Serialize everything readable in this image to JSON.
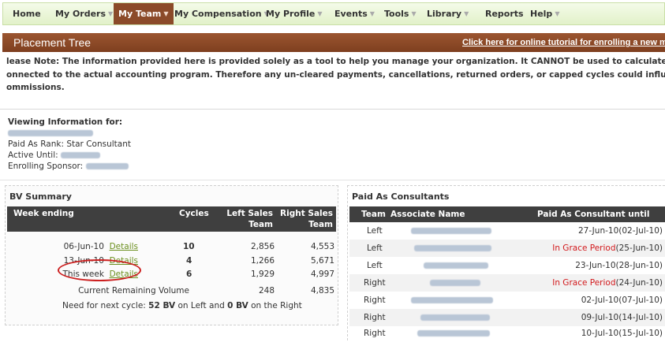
{
  "nav": {
    "items": [
      {
        "label": "Home",
        "caret": false
      },
      {
        "label": "My Orders",
        "caret": true
      },
      {
        "label": "My Team",
        "caret": true,
        "active": true
      },
      {
        "label": "My Compensation",
        "caret": true
      },
      {
        "label": "My Profile",
        "caret": true
      },
      {
        "label": "Events",
        "caret": true
      },
      {
        "label": "Tools",
        "caret": true
      },
      {
        "label": "Library",
        "caret": true
      },
      {
        "label": "Reports",
        "caret": false
      },
      {
        "label": "Help",
        "caret": true
      }
    ]
  },
  "header": {
    "title": "Placement Tree",
    "tutorial_link": "Click here for online tutorial for enrolling a new m"
  },
  "note": {
    "line1": "lease Note: The information provided here is provided solely as a tool to help you manage your organization. It CANNOT be used to calculate your commission checks a",
    "line2": "onnected to the actual accounting program. Therefore any un-cleared payments, cancellations, returned orders, or capped cycles could influence your ultimate status a",
    "line3": "ommissions."
  },
  "viewing": {
    "heading": "Viewing Information for:",
    "rank_label": "Paid As Rank:",
    "rank_value": "Star Consultant",
    "active_label": "Active Until:",
    "sponsor_label": "Enrolling Sponsor:"
  },
  "bv_summary": {
    "title": "BV Summary",
    "columns": [
      "Week ending",
      "Cycles",
      "Left Sales",
      "Team",
      "Right Sales",
      "Team"
    ],
    "rows": [
      {
        "week": "06-Jun-10",
        "link": "Details",
        "cycles": "10",
        "left": "2,856",
        "right": "4,553"
      },
      {
        "week": "13-Jun-10",
        "link": "Details",
        "cycles": "4",
        "left": "1,266",
        "right": "5,671"
      },
      {
        "week": "This week",
        "link": "Details",
        "cycles": "6",
        "left": "1,929",
        "right": "4,997"
      }
    ],
    "remaining_label": "Current Remaining Volume",
    "remaining_left": "248",
    "remaining_right": "4,835",
    "need_prefix": "Need for next cycle:",
    "need_left": "52 BV",
    "need_mid": "on Left and",
    "need_right": "0 BV",
    "need_suffix": "on the Right"
  },
  "paid_as": {
    "title": "Paid As Consultants",
    "columns": [
      "Team",
      "Associate Name",
      "Paid As Consultant until"
    ],
    "rows": [
      {
        "team": "Left",
        "grace": "",
        "until": "27-Jun-10(02-Jul-10)"
      },
      {
        "team": "Left",
        "grace": "In Grace Period",
        "until": "(25-Jun-10)"
      },
      {
        "team": "Left",
        "grace": "",
        "until": "23-Jun-10(28-Jun-10)"
      },
      {
        "team": "Right",
        "grace": "In Grace Period",
        "until": "(24-Jun-10)"
      },
      {
        "team": "Right",
        "grace": "",
        "until": "02-Jul-10(07-Jul-10)"
      },
      {
        "team": "Right",
        "grace": "",
        "until": "09-Jul-10(14-Jul-10)"
      },
      {
        "team": "Right",
        "grace": "",
        "until": "10-Jul-10(15-Jul-10)"
      }
    ]
  },
  "colors": {
    "nav_active": "#8b4a29",
    "header_bar": "#8b4a29",
    "link_green": "#6b8f1e",
    "grace_red": "#d2191c",
    "table_header": "#3f3f3f"
  }
}
